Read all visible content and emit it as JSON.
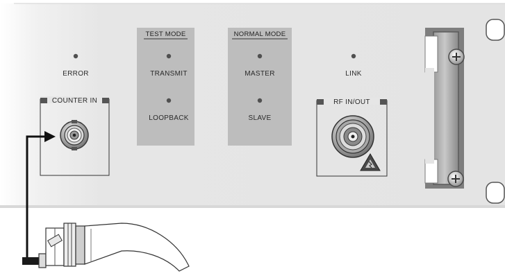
{
  "panel": {
    "test_mode": {
      "title": "TEST MODE",
      "transmit": "TRANSMIT",
      "loopback": "LOOPBACK"
    },
    "normal_mode": {
      "title": "NORMAL MODE",
      "master": "MASTER",
      "slave": "SLAVE"
    },
    "error_label": "ERROR",
    "link_label": "LINK",
    "counter_in_label": "COUNTER IN",
    "rf_in_out_label": "RF IN/OUT"
  },
  "colors": {
    "panel": "#e6e6e6",
    "mode_box": "#bdbdbd",
    "led": "#505050"
  },
  "icons": [
    "bnc-connector-icon",
    "n-type-connector-icon",
    "esd-warning-icon",
    "screw-icon",
    "cable-plug-icon",
    "arrow-icon"
  ]
}
